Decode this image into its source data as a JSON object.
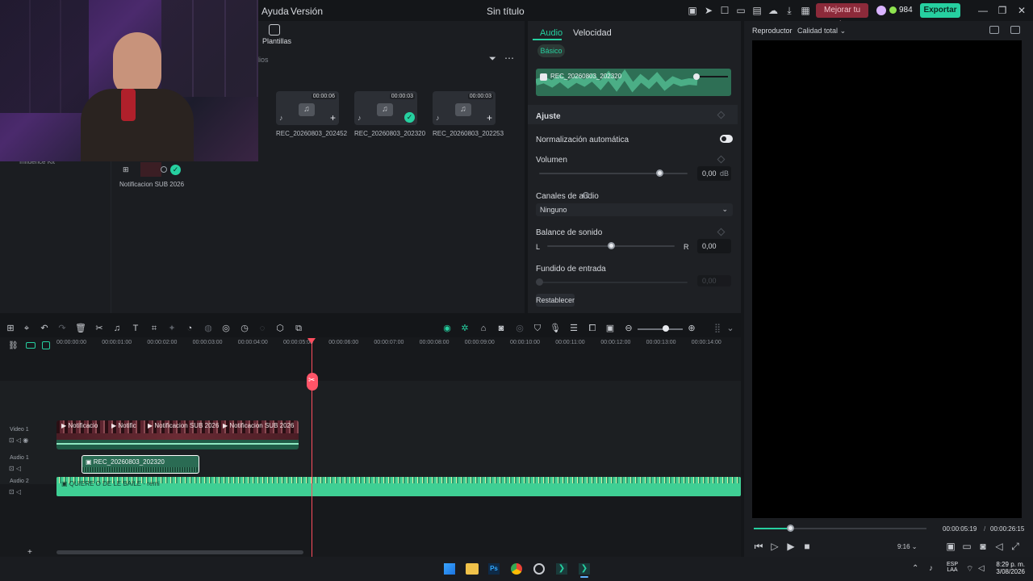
{
  "menu": {
    "help": "Ayuda",
    "version": "Versión"
  },
  "doc_title": "Sin título",
  "upgrade_label": "Mejorar tu Plan",
  "credits": "984",
  "export_label": "Exportar",
  "media": {
    "templates_tab": "Plantillas",
    "search_fragment": "dios",
    "side_fragment": "Influence Kit",
    "items": [
      {
        "duration": "00:00:06",
        "name": "REC_20260803_202452"
      },
      {
        "duration": "00:00:03",
        "name": "REC_20260803_202320"
      },
      {
        "duration": "00:00:03",
        "name": "REC_20260803_202253"
      }
    ],
    "sub_item": "Notificacion SUB 2026"
  },
  "props": {
    "tab_audio": "Audio",
    "tab_speed": "Velocidad",
    "basic": "Básico",
    "clip_name": "REC_20260803_202320",
    "adjust": "Ajuste",
    "auto_norm": "Normalización automática",
    "volume": "Volumen",
    "volume_value": "0,00",
    "volume_unit": "dB",
    "channels": "Canales de audio",
    "channels_value": "Ninguno",
    "balance": "Balance de sonido",
    "balance_l": "L",
    "balance_r": "R",
    "balance_value": "0,00",
    "fade_in": "Fundido de entrada",
    "fade_value": "0,00",
    "reset": "Restablecer"
  },
  "player": {
    "title": "Reproductor",
    "quality": "Calidad total",
    "current": "00:00:05:19",
    "sep": "/",
    "total": "00:00:26:15",
    "ratio": "9:16",
    "progress": 0.21
  },
  "timeline": {
    "ticks": [
      "00:00:00:00",
      "00:00:01:00",
      "00:00:02:00",
      "00:00:03:00",
      "00:00:04:00",
      "00:00:05:00",
      "00:00:06:00",
      "00:00:07:00",
      "00:00:08:00",
      "00:00:09:00",
      "00:00:10:00",
      "00:00:11:00",
      "00:00:12:00",
      "00:00:13:00",
      "00:00:14:00"
    ],
    "tracks": {
      "video1": "Video 1",
      "audio1": "Audio 1",
      "audio2": "Audio 2"
    },
    "video_clips": [
      "Notificacio",
      "Notific",
      "Notificacion SUB 2026",
      "Notificacion SUB 2026"
    ],
    "audio1_clip": "REC_20260803_202320",
    "audio2_clip": "QUIERE O DE LE BAILE - remi"
  },
  "taskbar": {
    "lang": "ESP",
    "layout": "LAA",
    "time": "8:29 p. m.",
    "date": "3/08/2026"
  },
  "colors": {
    "accent": "#26d0a0",
    "playhead": "#ff4d5e",
    "upgrade": "#8c2a3a",
    "audio_clip": "#3fcf94"
  }
}
